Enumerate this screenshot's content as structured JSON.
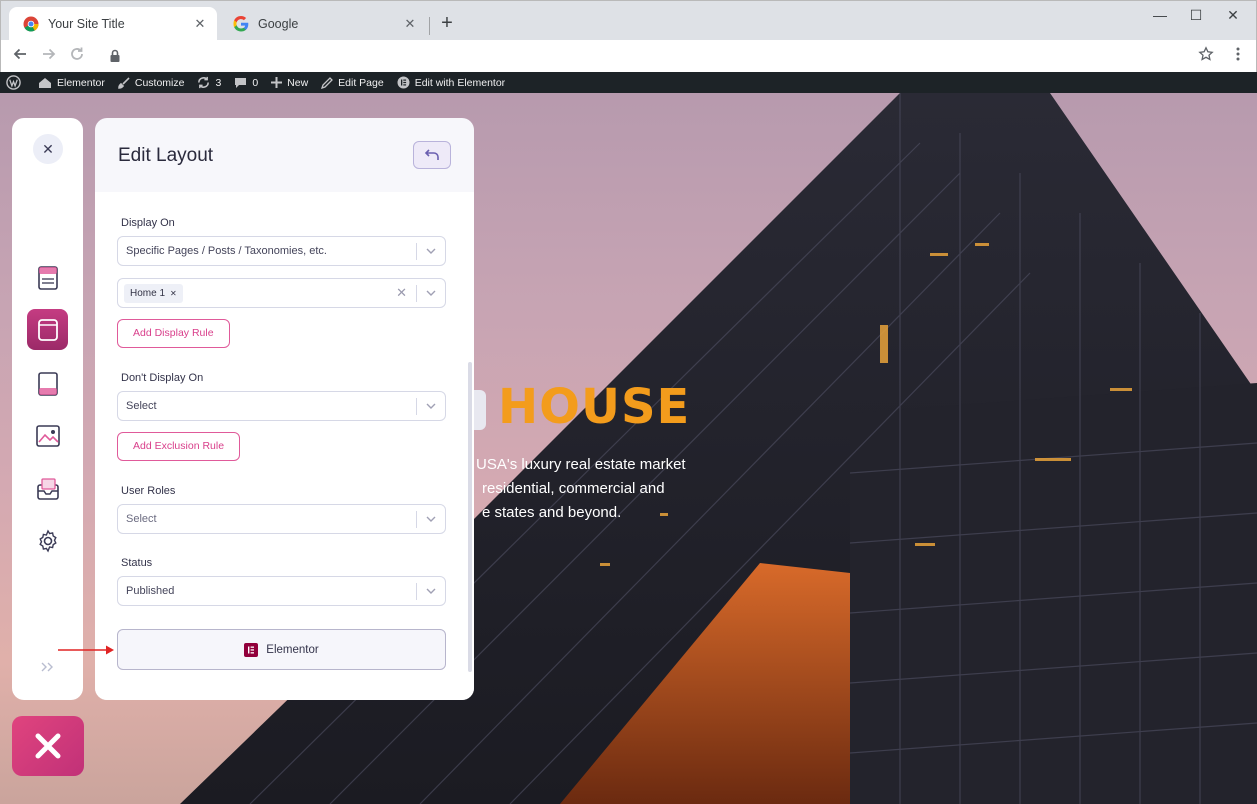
{
  "browser": {
    "tabs": [
      {
        "title": "Your Site Title",
        "active": true
      },
      {
        "title": "Google",
        "active": false
      }
    ],
    "new_tab": "+",
    "close_glyph": "✕",
    "window": {
      "minimize": "—",
      "maximize": "☐",
      "close": "✕"
    }
  },
  "admin_bar": {
    "site_name": "Elementor",
    "customize": "Customize",
    "updates_count": "3",
    "comments_count": "0",
    "new": "New",
    "edit_page": "Edit Page",
    "edit_with_elementor": "Edit with Elementor"
  },
  "hero": {
    "title": "HOUSE",
    "lines": [
      "USA's luxury real estate market",
      "residential, commercial and",
      "e states and beyond."
    ]
  },
  "panel": {
    "title": "Edit Layout",
    "display_on": {
      "label": "Display On",
      "value": "Specific Pages / Posts / Taxonomies, etc.",
      "chips": [
        "Home 1"
      ],
      "add_rule": "Add Display Rule"
    },
    "dont_display_on": {
      "label": "Don't Display On",
      "value": "Select",
      "add_rule": "Add Exclusion Rule"
    },
    "user_roles": {
      "label": "User Roles",
      "placeholder": "Select"
    },
    "status": {
      "label": "Status",
      "value": "Published"
    },
    "editor_button": "Elementor"
  },
  "colors": {
    "accent": "#d93f8b",
    "hero_title": "#f39c1c",
    "admin_bar": "#1d2327"
  },
  "icons": {
    "rail": [
      "close-icon",
      "header-layout-icon",
      "layout-icon",
      "footer-layout-icon",
      "gallery-icon",
      "inbox-icon",
      "gear-icon",
      "double-chevron-icon"
    ]
  }
}
